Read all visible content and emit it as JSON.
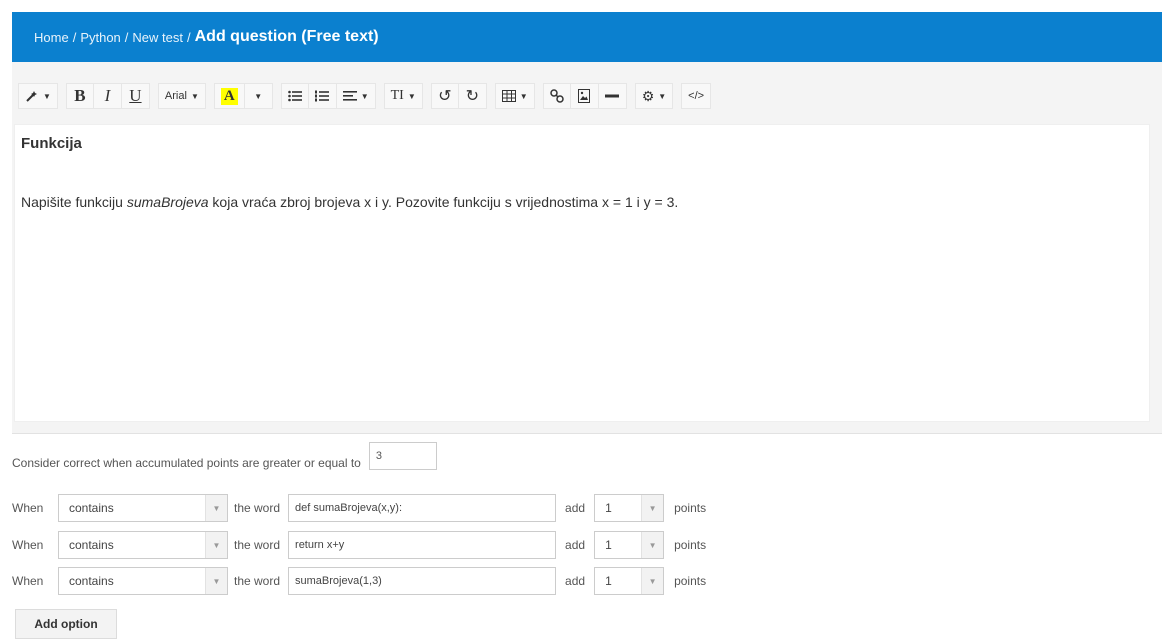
{
  "header": {
    "breadcrumb": [
      "Home",
      "Python",
      "New test"
    ],
    "separator": "/",
    "title": "Add question (Free text)",
    "background": "#0b80cf"
  },
  "toolbar": {
    "bold_label": "B",
    "italic_label": "I",
    "underline_label": "U",
    "font_name": "Arial",
    "color_label": "A",
    "fontsize_label": "TI",
    "icons": [
      "magic-icon",
      "bold-icon",
      "italic-icon",
      "underline-icon",
      "font-icon",
      "text-color-icon",
      "unordered-list-icon",
      "ordered-list-icon",
      "paragraph-icon",
      "font-size-icon",
      "undo-icon",
      "redo-icon",
      "table-icon",
      "link-icon",
      "picture-icon",
      "hr-icon",
      "settings-icon",
      "code-icon"
    ]
  },
  "editor": {
    "heading": "Funkcija",
    "text_before": "Napišite funkciju ",
    "text_em": "sumaBrojeva",
    "text_after": " koja vraća zbroj brojeva x i y. Pozovite funkciju s vrijednostima x = 1 i y = 3."
  },
  "criteria": {
    "label": "Consider correct when accumulated points are greater or equal to",
    "value": "3"
  },
  "rules": [
    {
      "when": "When",
      "operator": "contains",
      "the_word": "the word",
      "word": "def sumaBrojeva(x,y):",
      "add": "add",
      "points": "1",
      "points_label": "points"
    },
    {
      "when": "When",
      "operator": "contains",
      "the_word": "the word",
      "word": "return x+y",
      "add": "add",
      "points": "1",
      "points_label": "points"
    },
    {
      "when": "When",
      "operator": "contains",
      "the_word": "the word",
      "word": "sumaBrojeva(1,3)",
      "add": "add",
      "points": "1",
      "points_label": "points"
    }
  ],
  "add_option_label": "Add option"
}
